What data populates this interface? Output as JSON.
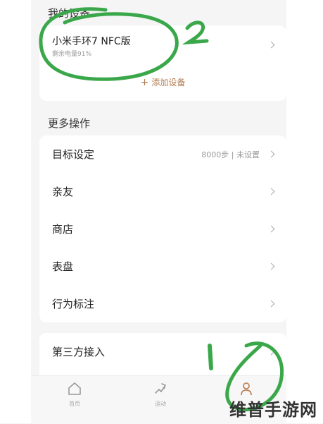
{
  "sections": {
    "devices_title": "我的设备",
    "more_title": "更多操作"
  },
  "device": {
    "name": "小米手环7 NFC版",
    "battery": "剩余电量91%",
    "add_label": "添加设备"
  },
  "more_items": [
    {
      "label": "目标设定",
      "value": "8000步 | 未设置"
    },
    {
      "label": "亲友"
    },
    {
      "label": "商店"
    },
    {
      "label": "表盘"
    },
    {
      "label": "行为标注"
    }
  ],
  "third_party": {
    "label": "第三方接入"
  },
  "tabbar": {
    "home": "首页",
    "sport": "运动"
  },
  "icons": [
    "home-icon",
    "sport-icon",
    "profile-icon",
    "chevron-right-icon",
    "plus-icon"
  ],
  "colors": {
    "accent": "#b07a50",
    "annotation": "#3aa84a"
  },
  "annotations": {
    "one": "1",
    "two": "2"
  },
  "watermark": "维普手游网"
}
